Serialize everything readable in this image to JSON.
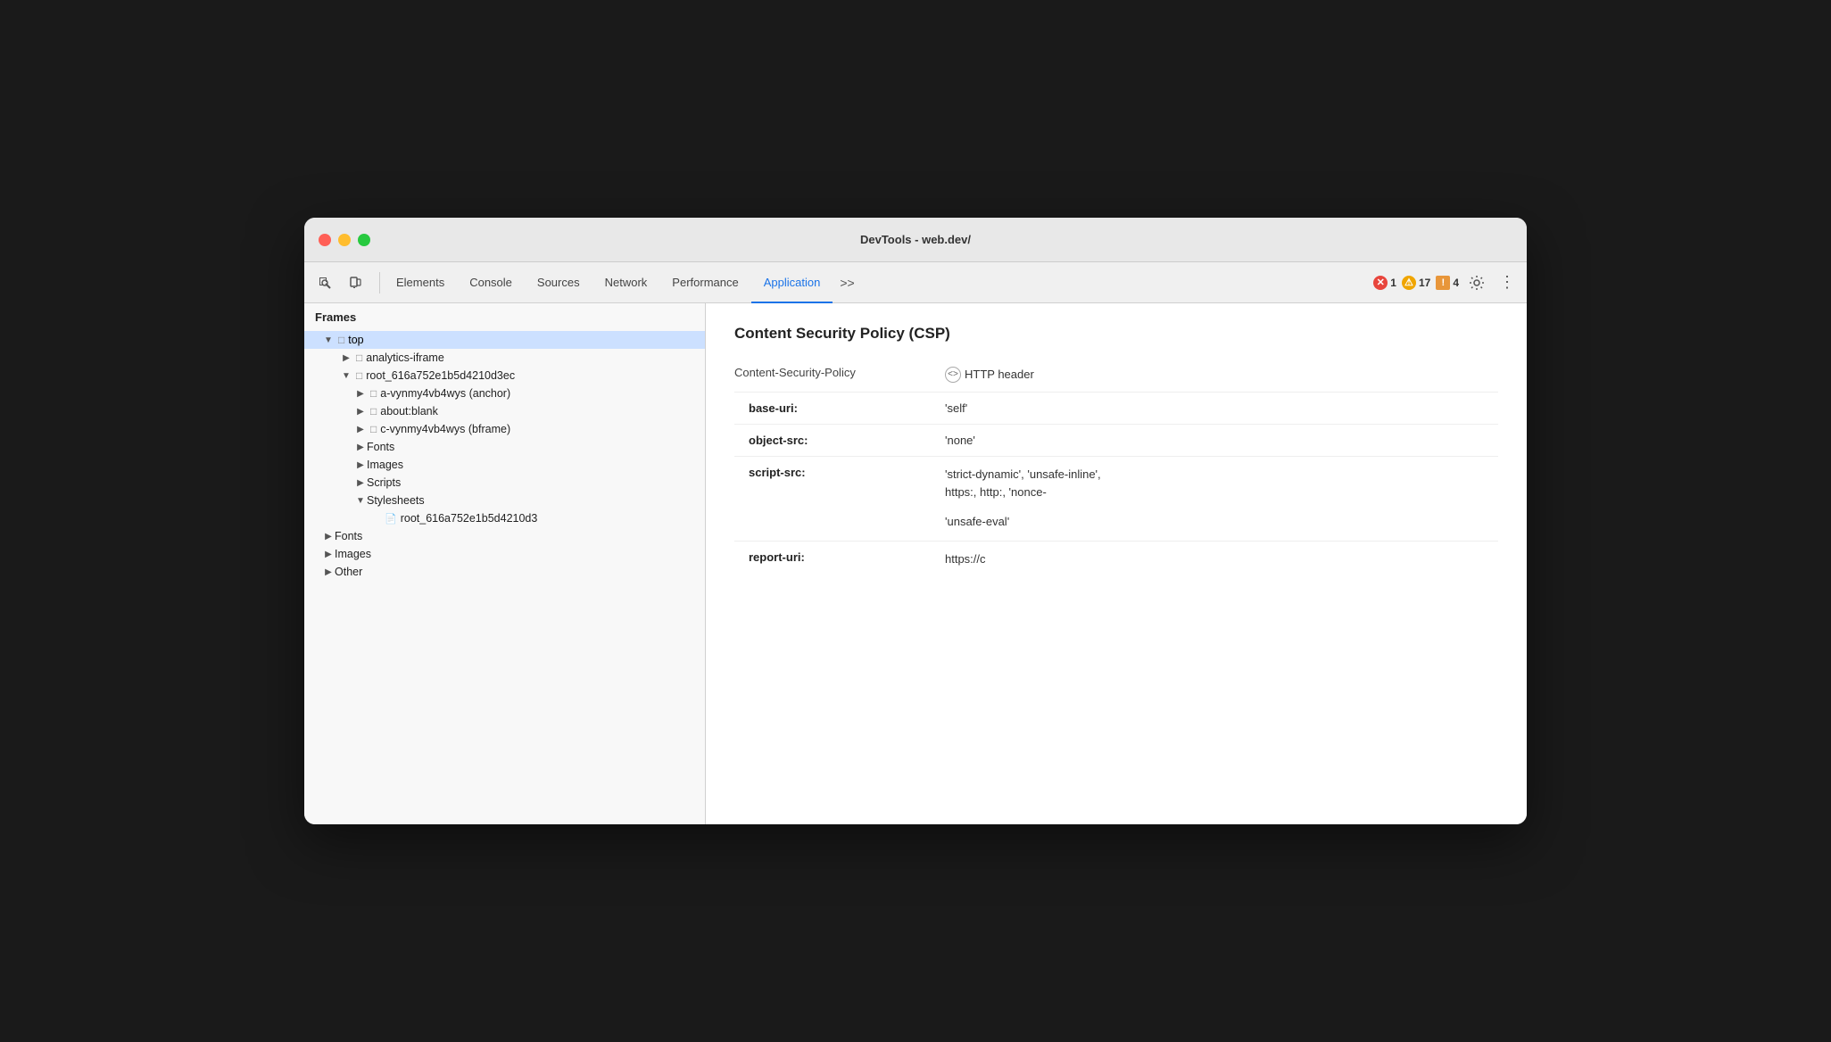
{
  "window": {
    "title": "DevTools - web.dev/"
  },
  "toolbar": {
    "tabs": [
      {
        "id": "elements",
        "label": "Elements",
        "active": false
      },
      {
        "id": "console",
        "label": "Console",
        "active": false
      },
      {
        "id": "sources",
        "label": "Sources",
        "active": false
      },
      {
        "id": "network",
        "label": "Network",
        "active": false
      },
      {
        "id": "performance",
        "label": "Performance",
        "active": false
      },
      {
        "id": "application",
        "label": "Application",
        "active": true
      }
    ],
    "more_label": ">>",
    "errors": {
      "icon": "✕",
      "count": "1"
    },
    "warnings": {
      "icon": "⚠",
      "count": "17"
    },
    "infos": {
      "icon": "!",
      "count": "4"
    }
  },
  "sidebar": {
    "section_label": "Frames",
    "items": [
      {
        "id": "top",
        "label": "top",
        "indent": 1,
        "type": "folder",
        "open": true,
        "selected": false
      },
      {
        "id": "analytics-iframe",
        "label": "analytics-iframe",
        "indent": 2,
        "type": "folder",
        "open": false,
        "selected": false
      },
      {
        "id": "root-frame",
        "label": "root_616a752e1b5d4210d3ec",
        "indent": 2,
        "type": "folder",
        "open": true,
        "selected": false
      },
      {
        "id": "a-vynmy",
        "label": "a-vynmy4vb4wys (anchor)",
        "indent": 3,
        "type": "folder",
        "open": false,
        "selected": false
      },
      {
        "id": "about-blank",
        "label": "about:blank",
        "indent": 3,
        "type": "folder",
        "open": false,
        "selected": false
      },
      {
        "id": "c-vynmy",
        "label": "c-vynmy4vb4wys (bframe)",
        "indent": 3,
        "type": "folder",
        "open": false,
        "selected": false
      },
      {
        "id": "fonts-inner",
        "label": "Fonts",
        "indent": 3,
        "type": "group",
        "open": false,
        "selected": false
      },
      {
        "id": "images-inner",
        "label": "Images",
        "indent": 3,
        "type": "group",
        "open": false,
        "selected": false
      },
      {
        "id": "scripts-inner",
        "label": "Scripts",
        "indent": 3,
        "type": "group",
        "open": false,
        "selected": false
      },
      {
        "id": "stylesheets-inner",
        "label": "Stylesheets",
        "indent": 3,
        "type": "group",
        "open": true,
        "selected": false
      },
      {
        "id": "root-file",
        "label": "root_616a752e1b5d4210d3",
        "indent": 4,
        "type": "file",
        "open": false,
        "selected": false
      },
      {
        "id": "fonts-outer",
        "label": "Fonts",
        "indent": 1,
        "type": "group",
        "open": false,
        "selected": false
      },
      {
        "id": "images-outer",
        "label": "Images",
        "indent": 1,
        "type": "group",
        "open": false,
        "selected": false
      },
      {
        "id": "other-outer",
        "label": "Other",
        "indent": 1,
        "type": "group",
        "open": false,
        "selected": false
      }
    ]
  },
  "content": {
    "title": "Content Security Policy (CSP)",
    "policy_key": "Content-Security-Policy",
    "policy_source_icon": "<>",
    "policy_source_label": "HTTP header",
    "directives": [
      {
        "key": "base-uri",
        "value": "'self'"
      },
      {
        "key": "object-src",
        "value": "'none'"
      },
      {
        "key": "script-src",
        "value": "'strict-dynamic', 'unsafe-inline',"
      },
      {
        "key": "",
        "value": "https:, http:, 'nonce-"
      },
      {
        "key": "",
        "value": ""
      },
      {
        "key": "",
        "value": "'unsafe-eval'"
      },
      {
        "key": "report-uri",
        "value": ""
      },
      {
        "key": "",
        "value": "https://c"
      }
    ]
  }
}
